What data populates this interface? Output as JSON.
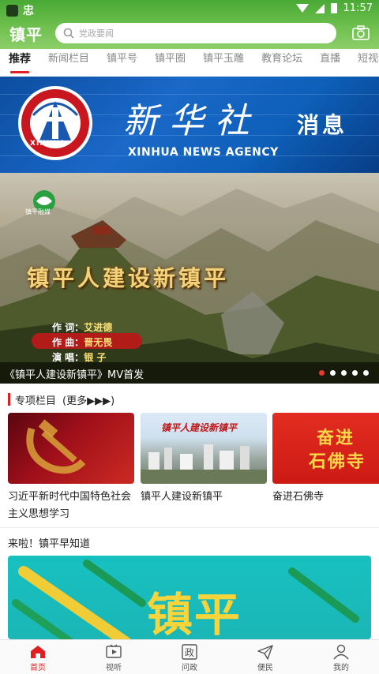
{
  "status_bar": {
    "app_indicator": "忠",
    "time": "11:57"
  },
  "header": {
    "logo": "镇平",
    "search_placeholder": "党政要闻",
    "icons": {
      "search": "search-icon",
      "camera": "camera-icon"
    }
  },
  "tabs": [
    {
      "label": "推荐",
      "active": true
    },
    {
      "label": "新闻栏目",
      "active": false
    },
    {
      "label": "镇平号",
      "active": false
    },
    {
      "label": "镇平圈",
      "active": false
    },
    {
      "label": "镇平玉雕",
      "active": false
    },
    {
      "label": "教育论坛",
      "active": false
    },
    {
      "label": "直播",
      "active": false
    },
    {
      "label": "短视频",
      "active": false
    }
  ],
  "xinhua_banner": {
    "emblem_text": "XINHUA",
    "title_cn": "新华社",
    "message": "消息",
    "title_en": "XINHUA NEWS AGENCY"
  },
  "carousel": {
    "badge": "镇平融媒",
    "mv_title": "镇平人建设新镇平",
    "credits": [
      {
        "role": "作 词：",
        "name": "艾进德"
      },
      {
        "role": "作 曲：",
        "name": "晋无畏"
      },
      {
        "role": "演 唱：",
        "name": "银 子"
      }
    ],
    "caption": "《镇平人建设新镇平》MV首发",
    "total_slides": 5,
    "active_slide": 1
  },
  "special_section": {
    "title": "专项栏目",
    "more_label": "(更多▶▶▶)",
    "cards": [
      {
        "label": "习近平新时代中国特色社会主义思想学习",
        "image_text": ""
      },
      {
        "label": "镇平人建设新镇平",
        "image_text": "镇平人建设新镇平"
      },
      {
        "label": "奋进石佛寺",
        "image_text_line1": "奋进",
        "image_text_line2": "石佛寺"
      }
    ]
  },
  "news_section": {
    "title": "来啦！镇平早知道",
    "promo_text": "镇平"
  },
  "bottom_nav": [
    {
      "label": "首页",
      "icon": "home-icon",
      "active": true
    },
    {
      "label": "视听",
      "icon": "play-icon",
      "active": false
    },
    {
      "label": "问政",
      "icon": "politics-icon",
      "active": false
    },
    {
      "label": "便民",
      "icon": "send-icon",
      "active": false
    },
    {
      "label": "我的",
      "icon": "user-icon",
      "active": false
    }
  ],
  "colors": {
    "header_green": "#6fc04f",
    "accent_red": "#e02020",
    "xinhua_blue": "#1a68c8"
  }
}
